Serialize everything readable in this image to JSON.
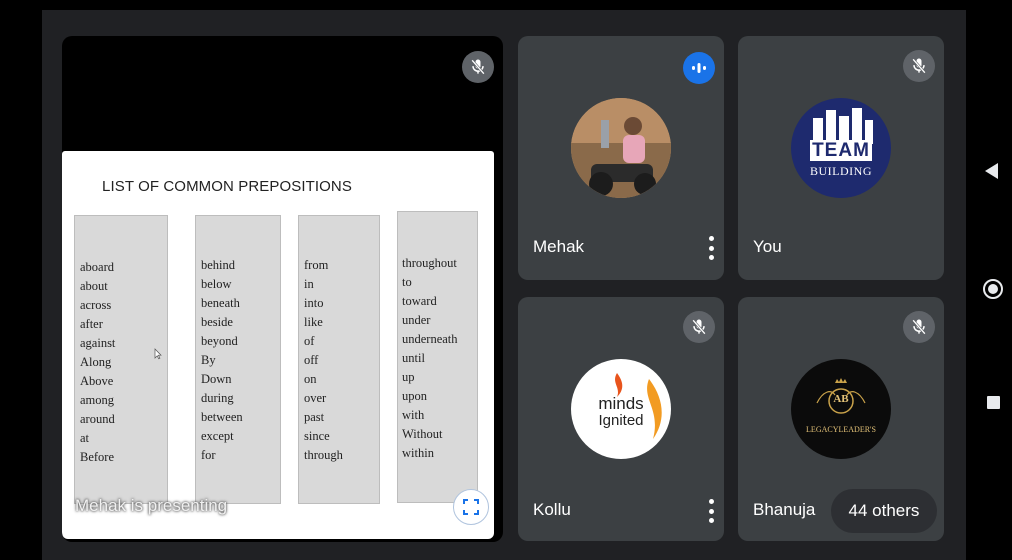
{
  "presentation": {
    "presenter_label": "Mehak is presenting",
    "mic_icon": "mic-off-icon",
    "fullscreen_icon": "fullscreen-icon",
    "slide": {
      "title": "LIST OF COMMON PREPOSITIONS",
      "columns": [
        [
          "aboard",
          "about",
          "across",
          "after",
          "against",
          "Along",
          "Above",
          "among",
          "around",
          "at",
          "Before"
        ],
        [
          "behind",
          "below",
          "beneath",
          "beside",
          "beyond",
          "By",
          "Down",
          "during",
          "between",
          "except",
          "for"
        ],
        [
          "from",
          "in",
          "into",
          "like",
          "of",
          "off",
          "on",
          "over",
          "past",
          "since",
          "through"
        ],
        [
          "throughout",
          "to",
          "toward",
          "under",
          "underneath",
          "until",
          "up",
          "upon",
          "with",
          "Without",
          "within"
        ]
      ]
    }
  },
  "participants": [
    {
      "name": "Mehak",
      "status_icon": "speaking-indicator-icon",
      "avatar": "photo"
    },
    {
      "name": "You",
      "status_icon": "mic-off-icon",
      "avatar_text": [
        "TEAM",
        "BUILDING"
      ]
    },
    {
      "name": "Kollu",
      "status_icon": "mic-off-icon",
      "avatar_text": [
        "minds",
        "Ignited"
      ]
    },
    {
      "name": "Bhanuja",
      "status_icon": "mic-off-icon",
      "avatar_text": [
        "AB",
        "LEGACYLEADER'S"
      ]
    }
  ],
  "others_label": "44 others",
  "colors": {
    "background": "#202124",
    "tile": "#3c4043",
    "accent": "#1a73e8",
    "badge": "#5f6368"
  }
}
